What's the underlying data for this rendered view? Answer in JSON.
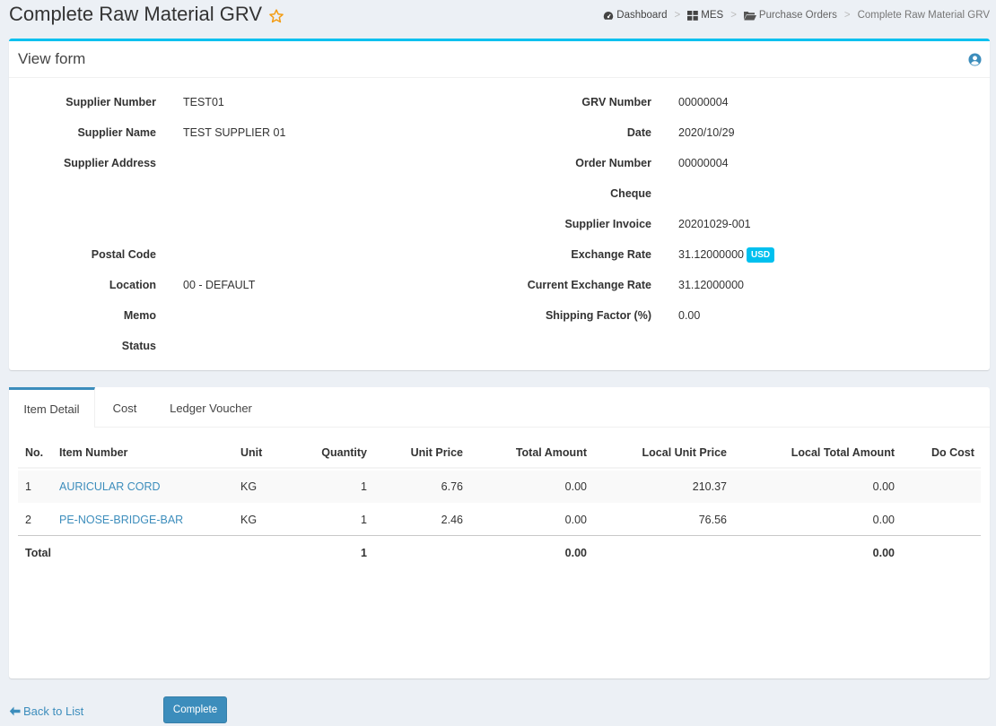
{
  "header": {
    "title": "Complete Raw Material GRV",
    "breadcrumb": {
      "dashboard": "Dashboard",
      "mes": "MES",
      "purchase_orders": "Purchase Orders",
      "current": "Complete Raw Material GRV"
    }
  },
  "form": {
    "title": "View form",
    "left": {
      "supplier_number_label": "Supplier Number",
      "supplier_number_value": "TEST01",
      "supplier_name_label": "Supplier Name",
      "supplier_name_value": "TEST SUPPLIER 01",
      "supplier_address_label": "Supplier Address",
      "postal_code_label": "Postal Code",
      "location_label": "Location",
      "location_value": "00 - DEFAULT",
      "memo_label": "Memo",
      "status_label": "Status"
    },
    "right": {
      "grv_number_label": "GRV Number",
      "grv_number_value": "00000004",
      "date_label": "Date",
      "date_value": "2020/10/29",
      "order_number_label": "Order Number",
      "order_number_value": "00000004",
      "cheque_label": "Cheque",
      "supplier_invoice_label": "Supplier Invoice",
      "supplier_invoice_value": "20201029-001",
      "exchange_rate_label": "Exchange Rate",
      "exchange_rate_value": "31.12000000",
      "currency_badge": "USD",
      "current_exchange_rate_label": "Current Exchange Rate",
      "current_exchange_rate_value": "31.12000000",
      "shipping_factor_label": "Shipping Factor (%)",
      "shipping_factor_value": "0.00"
    }
  },
  "tabs": [
    "Item Detail",
    "Cost",
    "Ledger Voucher"
  ],
  "table": {
    "headers": {
      "no": "No.",
      "item_number": "Item Number",
      "unit": "Unit",
      "quantity": "Quantity",
      "unit_price": "Unit Price",
      "total_amount": "Total Amount",
      "local_unit_price": "Local Unit Price",
      "local_total_amount": "Local Total Amount",
      "do_cost": "Do Cost"
    },
    "rows": [
      {
        "no": "1",
        "item_number": "AURICULAR CORD",
        "unit": "KG",
        "quantity": "1",
        "unit_price": "6.76",
        "total_amount": "0.00",
        "local_unit_price": "210.37",
        "local_total_amount": "0.00"
      },
      {
        "no": "2",
        "item_number": "PE-NOSE-BRIDGE-BAR",
        "unit": "KG",
        "quantity": "1",
        "unit_price": "2.46",
        "total_amount": "0.00",
        "local_unit_price": "76.56",
        "local_total_amount": "0.00"
      }
    ],
    "total": {
      "label": "Total",
      "quantity": "1",
      "total_amount": "0.00",
      "local_total_amount": "0.00"
    }
  },
  "footer": {
    "back_label": "Back to List",
    "complete_label": "Complete"
  },
  "colors": {
    "accent": "#3c8dbc",
    "info": "#00c0ef",
    "star": "#f39c12",
    "background": "#ecf0f5"
  },
  "icons": [
    "star-icon",
    "dashboard-icon",
    "grid-icon",
    "folder-open-icon",
    "user-circle-icon",
    "arrow-left-icon"
  ]
}
